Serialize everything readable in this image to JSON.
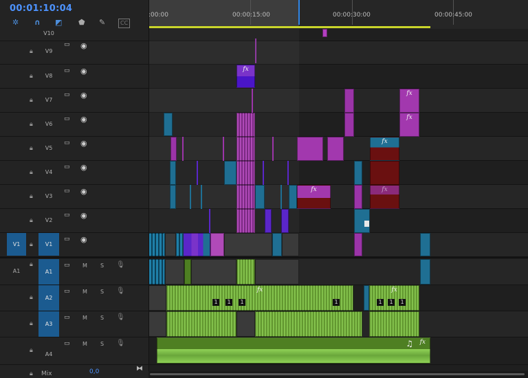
{
  "header": {
    "timecode": "00:01:10:04",
    "tools": [
      {
        "icon": "snap-icon",
        "glyph": "✲"
      },
      {
        "icon": "magnet-icon",
        "glyph": "∩"
      },
      {
        "icon": "linked-selection-icon",
        "glyph": "◩"
      },
      {
        "icon": "marker-icon",
        "glyph": "⬟"
      },
      {
        "icon": "wrench-icon",
        "glyph": "✎"
      },
      {
        "icon": "captions-icon",
        "glyph": "CC"
      }
    ]
  },
  "ruler": {
    "labels": [
      ":00:00",
      "00:00:15:00",
      "00:00:30:00",
      "00:00:45:00"
    ]
  },
  "tracks": {
    "video": [
      {
        "name": "V10"
      },
      {
        "name": "V9"
      },
      {
        "name": "V8"
      },
      {
        "name": "V7"
      },
      {
        "name": "V6"
      },
      {
        "name": "V5"
      },
      {
        "name": "V4"
      },
      {
        "name": "V3"
      },
      {
        "name": "V2"
      },
      {
        "name": "V1",
        "source": "V1",
        "targeted": true
      }
    ],
    "audio": [
      {
        "name": "A1",
        "source": "A1",
        "targeted": true
      },
      {
        "name": "A2",
        "targeted": true
      },
      {
        "name": "A3",
        "targeted": true
      },
      {
        "name": "A4",
        "targeted": false
      }
    ],
    "mute_label": "M",
    "solo_label": "S",
    "mix_label": "Mix",
    "mix_value": "0,0"
  },
  "clip_labels": {
    "fx": "fx",
    "keyframe": "1",
    "music_note": "♫"
  },
  "colors": {
    "accent": "#4d93ff",
    "purple": "#9b34a8",
    "violet": "#5a26c9",
    "cyan": "#1f6f93",
    "maroon": "#6a1010",
    "audio_green": "#4e7f22",
    "workbar": "#cad52b"
  }
}
